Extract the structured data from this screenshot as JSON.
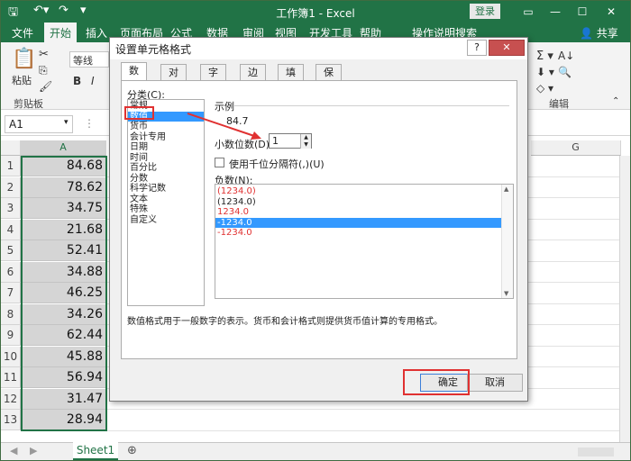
{
  "titlebar": {
    "title": "工作簿1  -  Excel",
    "login": "登录",
    "icons": [
      "save-icon",
      "undo-icon",
      "redo-icon",
      "customize-icon"
    ]
  },
  "ribbon_tabs": [
    "文件",
    "开始",
    "插入",
    "页面布局",
    "公式",
    "数据",
    "审阅",
    "视图",
    "开发工具",
    "帮助",
    "操作说明搜索"
  ],
  "share_label": "共享",
  "ribbon": {
    "paste": "粘贴",
    "clipboard": "剪贴板",
    "font_value": "等线",
    "bold": "B",
    "italic": "I",
    "edit_group": "编辑"
  },
  "namebox": "A1",
  "columns": [
    "A",
    "G"
  ],
  "rows": [
    {
      "num": "1",
      "value": "84.68"
    },
    {
      "num": "2",
      "value": "78.62"
    },
    {
      "num": "3",
      "value": "34.75"
    },
    {
      "num": "4",
      "value": "21.68"
    },
    {
      "num": "5",
      "value": "52.41"
    },
    {
      "num": "6",
      "value": "34.88"
    },
    {
      "num": "7",
      "value": "46.25"
    },
    {
      "num": "8",
      "value": "34.26"
    },
    {
      "num": "9",
      "value": "62.44"
    },
    {
      "num": "10",
      "value": "45.88"
    },
    {
      "num": "11",
      "value": "56.94"
    },
    {
      "num": "12",
      "value": "31.47"
    },
    {
      "num": "13",
      "value": "28.94"
    }
  ],
  "sheet_tab": "Sheet1",
  "dialog": {
    "title": "设置单元格格式",
    "help": "?",
    "close": "✕",
    "tabs": [
      "数字",
      "对齐",
      "字体",
      "边框",
      "填充",
      "保护"
    ],
    "category_label": "分类(C):",
    "categories": [
      "常规",
      "数值",
      "货币",
      "会计专用",
      "日期",
      "时间",
      "百分比",
      "分数",
      "科学记数",
      "文本",
      "特殊",
      "自定义"
    ],
    "selected_category": "数值",
    "sample_label": "示例",
    "sample_value": "84.7",
    "decimal_label": "小数位数(D):",
    "decimal_value": "1",
    "thousands_label": "使用千位分隔符(,)(U)",
    "negative_label": "负数(N):",
    "negative_options": [
      "(1234.0)",
      "(1234.0)",
      "1234.0",
      "-1234.0",
      "-1234.0"
    ],
    "description": "数值格式用于一般数字的表示。货币和会计格式则提供货币值计算的专用格式。",
    "ok": "确定",
    "cancel": "取消"
  },
  "colors": {
    "excel_green": "#217346",
    "selection_blue": "#3399ff",
    "negative_red": "#e03131",
    "highlight_red": "#e03131"
  }
}
